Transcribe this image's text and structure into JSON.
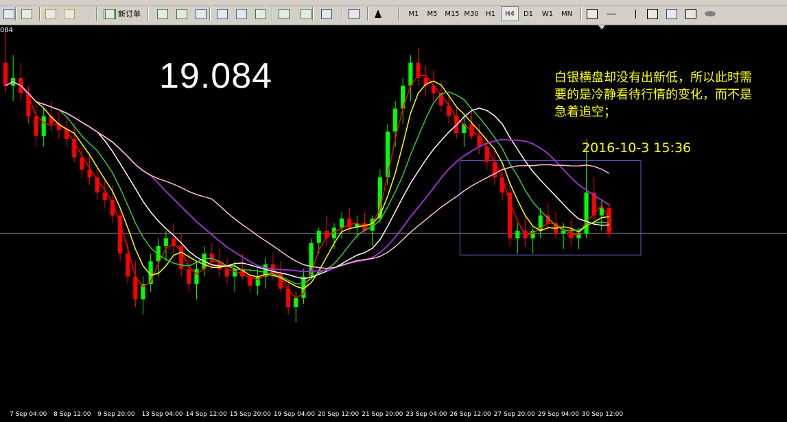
{
  "toolbar": {
    "new_order_label": "新订单",
    "timeframes": [
      "M1",
      "M5",
      "M15",
      "M30",
      "H1",
      "H4",
      "D1",
      "W1",
      "MN"
    ],
    "active_timeframe": "H4",
    "icons": [
      "chart-window-icon",
      "properties-icon",
      "market-watch-icon",
      "navigator-icon",
      "new-order-icon",
      "bar-chart-icon",
      "candlestick-icon",
      "line-chart-icon",
      "zoom-in-icon",
      "zoom-out-icon",
      "tile-windows-icon",
      "autoscroll-icon",
      "chart-shift-icon",
      "indicators-icon",
      "periods-icon",
      "templates-icon",
      "cursor-icon",
      "crosshair-icon",
      "horizontal-line-icon",
      "vertical-line-icon",
      "trendline-icon",
      "fibonacci-icon",
      "text-label-icon",
      "ellipse-icon"
    ]
  },
  "chart": {
    "price_axis_label": "084",
    "big_price": "19.084",
    "comment_lines": [
      "白银横盘却没有出新低，所以此时需",
      "要的是冷静看待行情的变化，而不是",
      "急着追空；"
    ],
    "date_note": "2016-10-3  15:36"
  },
  "colors": {
    "background": "#000000",
    "bull": "#00ff00",
    "bear": "#ff0000",
    "ma_red": "#ff0000",
    "ma_yellow": "#ffff00",
    "ma_green": "#32cd32",
    "ma_white": "#ffffff",
    "ma_purple": "#9932cc",
    "ma_pink": "#ffc0cb",
    "text": "#ffff00",
    "box": "#6a5acd"
  },
  "chart_data": {
    "type": "candlestick",
    "x_tick_labels": [
      "7 Sep 04:00",
      "8 Sep 12:00",
      "9 Sep 20:00",
      "13 Sep 04:00",
      "14 Sep 12:00",
      "15 Sep 20:00",
      "19 Sep 04:00",
      "20 Sep 12:00",
      "21 Sep 20:00",
      "23 Sep 04:00",
      "26 Sep 12:00",
      "27 Sep 20:00",
      "29 Sep 04:00",
      "30 Sep 12:00"
    ],
    "current_price": 19.084,
    "ylim": [
      18.0,
      20.4
    ],
    "candles": [
      [
        20.2,
        20.4,
        20.0,
        20.05
      ],
      [
        20.05,
        20.25,
        19.95,
        20.1
      ],
      [
        20.1,
        20.2,
        19.95,
        20.0
      ],
      [
        20.0,
        20.05,
        19.8,
        19.85
      ],
      [
        19.85,
        19.95,
        19.65,
        19.72
      ],
      [
        19.72,
        19.9,
        19.65,
        19.85
      ],
      [
        19.85,
        19.95,
        19.75,
        19.8
      ],
      [
        19.8,
        19.88,
        19.7,
        19.76
      ],
      [
        19.76,
        19.85,
        19.65,
        19.7
      ],
      [
        19.7,
        19.8,
        19.55,
        19.58
      ],
      [
        19.58,
        19.65,
        19.45,
        19.5
      ],
      [
        19.5,
        19.6,
        19.4,
        19.45
      ],
      [
        19.45,
        19.52,
        19.3,
        19.35
      ],
      [
        19.35,
        19.45,
        19.25,
        19.3
      ],
      [
        19.3,
        19.4,
        19.15,
        19.2
      ],
      [
        19.2,
        19.25,
        18.9,
        18.95
      ],
      [
        18.95,
        19.05,
        18.75,
        18.8
      ],
      [
        18.8,
        18.9,
        18.6,
        18.65
      ],
      [
        18.65,
        18.8,
        18.55,
        18.75
      ],
      [
        18.75,
        18.95,
        18.7,
        18.9
      ],
      [
        18.9,
        19.05,
        18.8,
        19.0
      ],
      [
        19.0,
        19.1,
        18.9,
        19.05
      ],
      [
        19.05,
        19.15,
        18.95,
        19.0
      ],
      [
        19.0,
        19.08,
        18.8,
        18.85
      ],
      [
        18.85,
        18.95,
        18.7,
        18.75
      ],
      [
        18.75,
        18.9,
        18.65,
        18.85
      ],
      [
        18.85,
        19.0,
        18.8,
        18.95
      ],
      [
        18.95,
        19.02,
        18.85,
        18.9
      ],
      [
        18.9,
        18.98,
        18.8,
        18.85
      ],
      [
        18.85,
        18.92,
        18.75,
        18.8
      ],
      [
        18.8,
        18.9,
        18.7,
        18.85
      ],
      [
        18.85,
        18.95,
        18.78,
        18.8
      ],
      [
        18.8,
        18.88,
        18.7,
        18.74
      ],
      [
        18.74,
        18.85,
        18.68,
        18.8
      ],
      [
        18.8,
        18.92,
        18.72,
        18.88
      ],
      [
        18.88,
        18.95,
        18.78,
        18.82
      ],
      [
        18.82,
        18.9,
        18.7,
        18.72
      ],
      [
        18.72,
        18.78,
        18.55,
        18.6
      ],
      [
        18.6,
        18.7,
        18.5,
        18.66
      ],
      [
        18.66,
        18.85,
        18.62,
        18.8
      ],
      [
        18.8,
        19.05,
        18.78,
        19.02
      ],
      [
        19.02,
        19.12,
        18.95,
        19.1
      ],
      [
        19.1,
        19.2,
        19.0,
        19.05
      ],
      [
        19.05,
        19.15,
        18.98,
        19.12
      ],
      [
        19.12,
        19.22,
        19.05,
        19.18
      ],
      [
        19.18,
        19.25,
        19.08,
        19.12
      ],
      [
        19.12,
        19.2,
        19.05,
        19.15
      ],
      [
        19.15,
        19.22,
        19.08,
        19.1
      ],
      [
        19.1,
        19.2,
        19.0,
        19.18
      ],
      [
        19.18,
        19.5,
        19.15,
        19.45
      ],
      [
        19.45,
        19.8,
        19.4,
        19.75
      ],
      [
        19.75,
        19.95,
        19.65,
        19.9
      ],
      [
        19.9,
        20.1,
        19.8,
        20.05
      ],
      [
        20.05,
        20.25,
        19.95,
        20.2
      ],
      [
        20.2,
        20.3,
        20.05,
        20.1
      ],
      [
        20.1,
        20.18,
        19.98,
        20.05
      ],
      [
        20.05,
        20.15,
        19.95,
        20.0
      ],
      [
        20.0,
        20.08,
        19.88,
        19.92
      ],
      [
        19.92,
        20.0,
        19.8,
        19.85
      ],
      [
        19.85,
        19.92,
        19.7,
        19.74
      ],
      [
        19.74,
        19.85,
        19.65,
        19.8
      ],
      [
        19.8,
        19.88,
        19.7,
        19.72
      ],
      [
        19.72,
        19.8,
        19.6,
        19.65
      ],
      [
        19.65,
        19.72,
        19.5,
        19.55
      ],
      [
        19.55,
        19.65,
        19.4,
        19.45
      ],
      [
        19.45,
        19.55,
        19.3,
        19.35
      ],
      [
        19.35,
        19.4,
        19.0,
        19.05
      ],
      [
        19.05,
        19.15,
        18.95,
        19.1
      ],
      [
        19.1,
        19.2,
        19.0,
        19.05
      ],
      [
        19.05,
        19.12,
        18.95,
        19.1
      ],
      [
        19.1,
        19.25,
        19.05,
        19.2
      ],
      [
        19.2,
        19.28,
        19.1,
        19.15
      ],
      [
        19.15,
        19.22,
        19.05,
        19.08
      ],
      [
        19.08,
        19.15,
        18.98,
        19.1
      ],
      [
        19.1,
        19.18,
        19.0,
        19.05
      ],
      [
        19.05,
        19.12,
        18.98,
        19.08
      ],
      [
        19.08,
        19.7,
        19.05,
        19.35
      ],
      [
        19.35,
        19.45,
        19.15,
        19.2
      ],
      [
        19.2,
        19.3,
        19.1,
        19.25
      ],
      [
        19.25,
        19.28,
        19.05,
        19.08
      ]
    ]
  }
}
